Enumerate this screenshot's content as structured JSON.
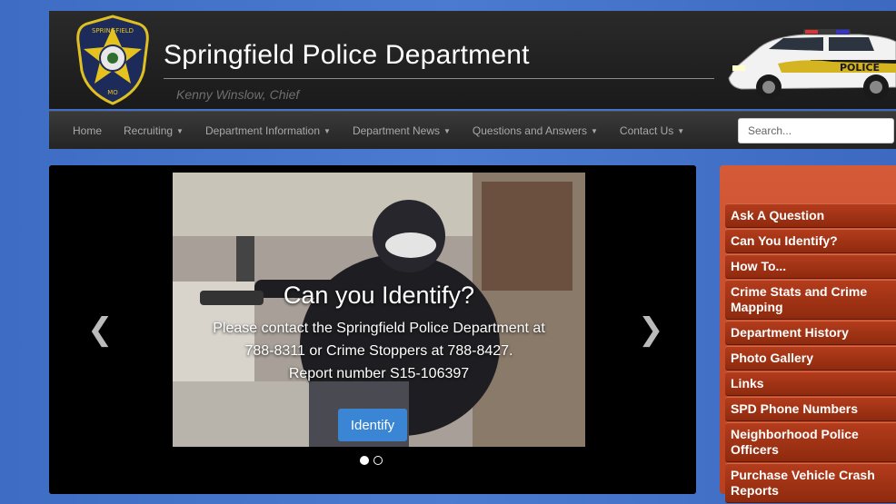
{
  "header": {
    "title": "Springfield Police Department",
    "subtitle": "Kenny Winslow, Chief",
    "badge_text": "SPRINGFIELD POLICE",
    "car_text": "POLICE"
  },
  "nav": {
    "items": [
      {
        "label": "Home",
        "dropdown": false
      },
      {
        "label": "Recruiting",
        "dropdown": true
      },
      {
        "label": "Department Information",
        "dropdown": true
      },
      {
        "label": "Department News",
        "dropdown": true
      },
      {
        "label": "Questions and Answers",
        "dropdown": true
      },
      {
        "label": "Contact Us",
        "dropdown": true
      }
    ],
    "search_placeholder": "Search..."
  },
  "carousel": {
    "heading": "Can you Identify?",
    "line1": "Please contact the Springfield Police Department at",
    "line2": "788-8311 or Crime Stoppers at 788-8427.",
    "line3": "Report number S15-106397",
    "button_label": "Identify",
    "prev_glyph": "❮",
    "next_glyph": "❯",
    "slide_count": 2,
    "active_slide": 1
  },
  "sidebar": {
    "items": [
      "Ask A Question",
      "Can You Identify?",
      "How To...",
      "Crime Stats and Crime Mapping",
      "Department History",
      "Photo Gallery",
      "Links",
      "SPD Phone Numbers",
      "Neighborhood Police Officers",
      "Purchase Vehicle Crash Reports"
    ]
  },
  "colors": {
    "background": "#4a7bd0",
    "header": "#1f1f1f",
    "sidebar": "#b8401f",
    "button": "#3a86d4"
  }
}
